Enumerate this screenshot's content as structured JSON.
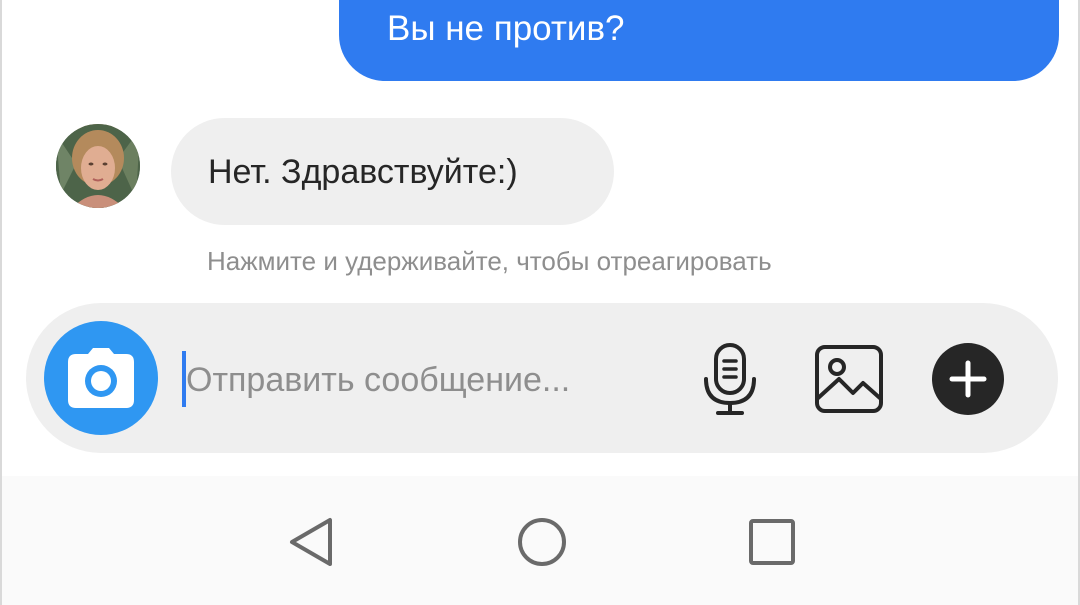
{
  "conversation": {
    "outgoing_message": "Вы не против?",
    "incoming_message": "Нет. Здравствуйте:)",
    "reaction_hint": "Нажмите и удерживайте, чтобы отреагировать"
  },
  "composer": {
    "placeholder": "Отправить сообщение...",
    "value": "",
    "icons": {
      "camera": "camera-icon",
      "microphone": "microphone-icon",
      "gallery": "image-icon",
      "add": "plus-icon"
    }
  },
  "navigation": {
    "icons": [
      "back-triangle-icon",
      "home-circle-icon",
      "recents-square-icon"
    ]
  },
  "colors": {
    "outgoing_bubble": "#2f7bf0",
    "incoming_bubble": "#efefef",
    "camera_button": "#2f97f2",
    "hint_text": "#8e8e8e"
  }
}
